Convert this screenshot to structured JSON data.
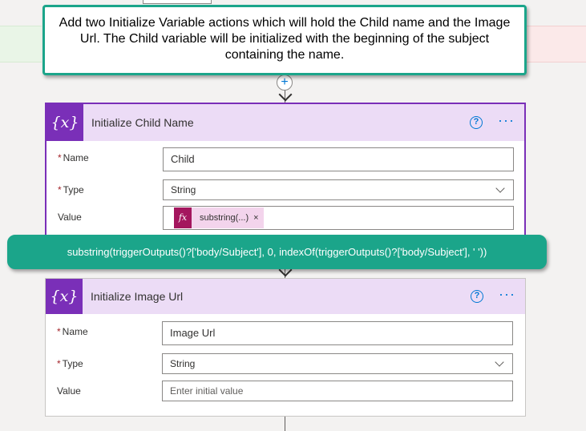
{
  "callout_top": {
    "text": "Add two Initialize Variable actions which will hold the Child name and the Image Url.  The Child variable will be initialized with the beginning of the subject containing the name."
  },
  "add_step": {
    "icon": "plus-icon",
    "glyph": "+"
  },
  "card_child": {
    "icon_glyph": "{x}",
    "title": "Initialize Child Name",
    "help_glyph": "?",
    "more_glyph": "···",
    "name_label": "Name",
    "name_value": "Child",
    "type_label": "Type",
    "type_value": "String",
    "value_label": "Value",
    "token_fx": "fx",
    "token_label": "substring(...)",
    "token_remove": "×",
    "required_mark": "*"
  },
  "callout_formula": {
    "text": "substring(triggerOutputs()?['body/Subject'], 0, indexOf(triggerOutputs()?['body/Subject'], ' '))"
  },
  "card_image": {
    "icon_glyph": "{x}",
    "title": "Initialize Image Url",
    "help_glyph": "?",
    "more_glyph": "···",
    "name_label": "Name",
    "name_value": "Image Url",
    "type_label": "Type",
    "type_value": "String",
    "value_label": "Value",
    "value_placeholder": "Enter initial value",
    "required_mark": "*"
  },
  "colors": {
    "accent": "#7a2fb8",
    "callout": "#1ba58a",
    "link": "#0078d4",
    "token": "#a4165e"
  }
}
